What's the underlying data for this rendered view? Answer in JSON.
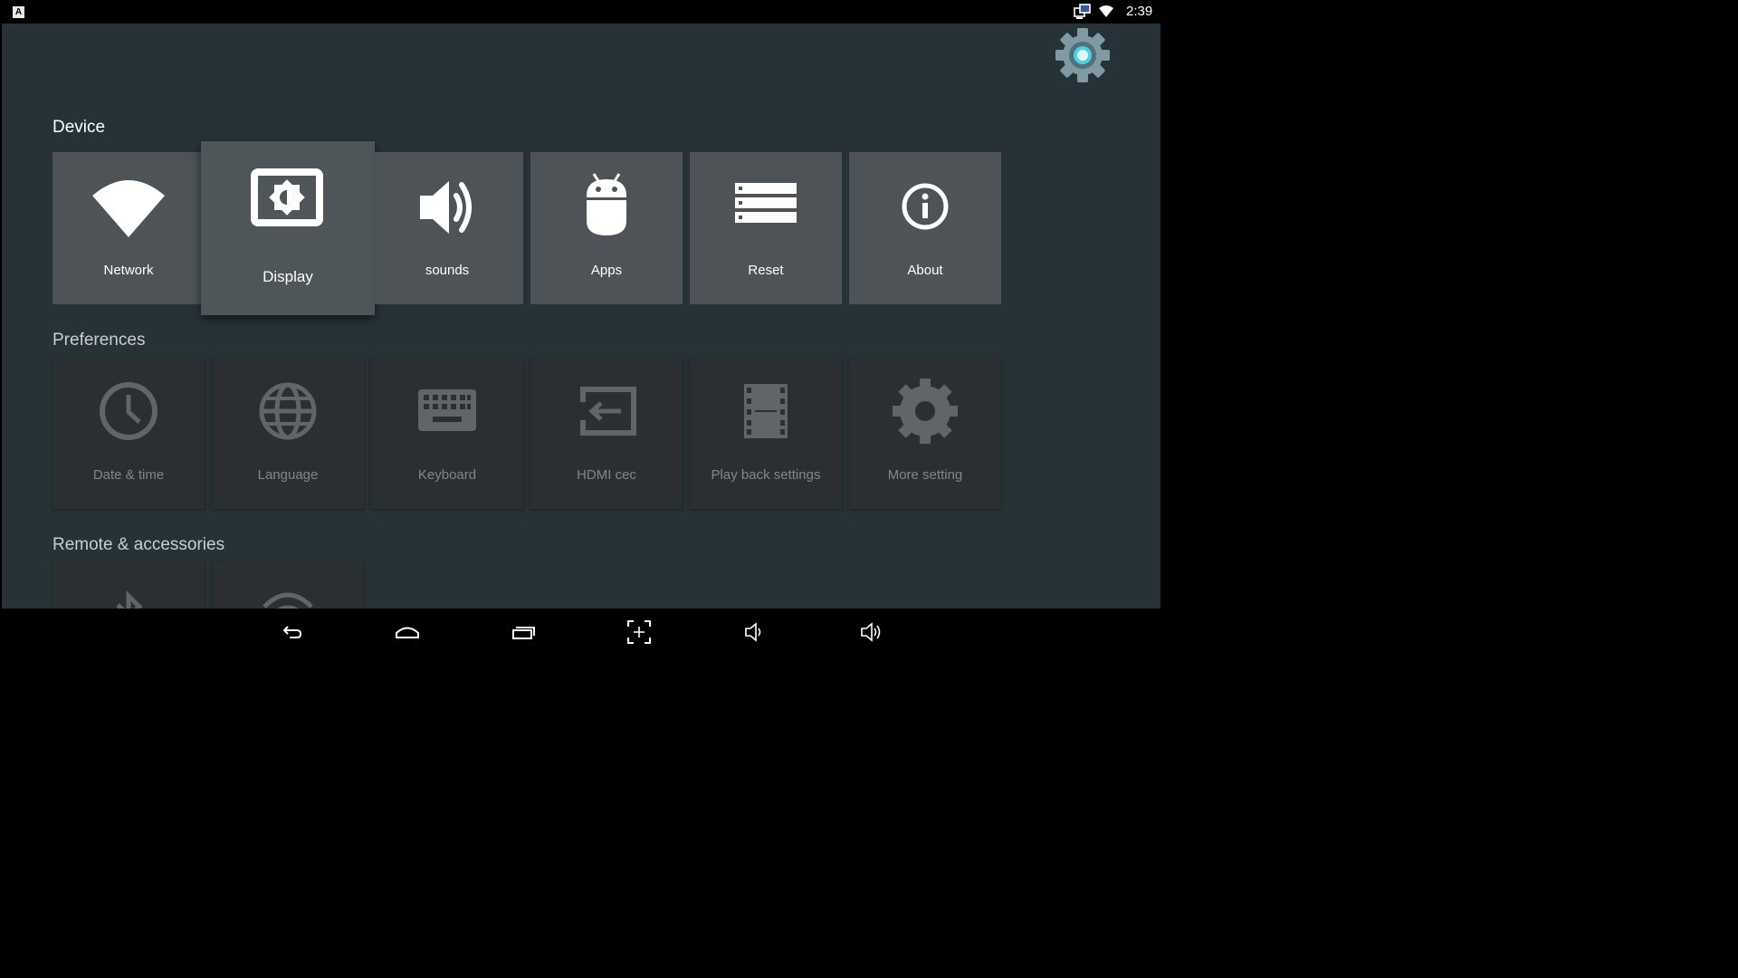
{
  "status_bar": {
    "time": "2:39",
    "left_icon_letter": "A"
  },
  "sections": {
    "device": {
      "title": "Device",
      "items": [
        {
          "label": "Network",
          "icon": "wifi-icon"
        },
        {
          "label": "Display",
          "icon": "display-icon"
        },
        {
          "label": "sounds",
          "icon": "speaker-icon"
        },
        {
          "label": "Apps",
          "icon": "android-icon"
        },
        {
          "label": "Reset",
          "icon": "reset-icon"
        },
        {
          "label": "About",
          "icon": "info-icon"
        }
      ]
    },
    "preferences": {
      "title": "Preferences",
      "items": [
        {
          "label": "Date & time",
          "icon": "clock-icon"
        },
        {
          "label": "Language",
          "icon": "globe-icon"
        },
        {
          "label": "Keyboard",
          "icon": "keyboard-icon"
        },
        {
          "label": "HDMI cec",
          "icon": "hdmi-input-icon"
        },
        {
          "label": "Play back settings",
          "icon": "film-icon"
        },
        {
          "label": "More setting",
          "icon": "gear-icon"
        }
      ]
    },
    "remote": {
      "title": "Remote & accessories",
      "items": [
        {
          "icon": "bluetooth-icon"
        },
        {
          "icon": "remote-signal-icon"
        }
      ]
    }
  },
  "focused_item": "Display",
  "nav_bar": [
    "back-icon",
    "home-icon",
    "recent-apps-icon",
    "screenshot-icon",
    "volume-down-icon",
    "volume-up-icon"
  ],
  "colors": {
    "background": "#263238",
    "tile": "#4d5356",
    "pref_tile": "#2b2f31",
    "accent": "#80deea"
  }
}
